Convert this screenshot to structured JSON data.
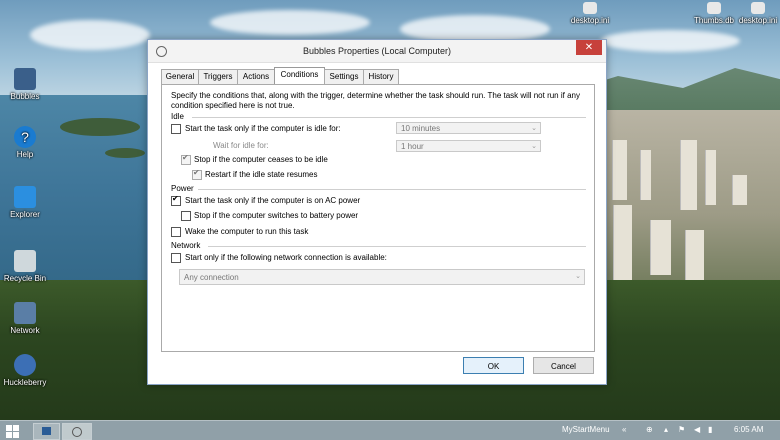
{
  "desktop": {
    "icons": [
      {
        "label": "Bubbles"
      },
      {
        "label": "Help"
      },
      {
        "label": "Explorer"
      },
      {
        "label": "Recycle Bin"
      },
      {
        "label": "Network"
      },
      {
        "label": "Huckleberry"
      }
    ],
    "top_icons": [
      {
        "label": "desktop.ini"
      },
      {
        "label": "Thumbs.db"
      },
      {
        "label": "desktop.ini"
      }
    ]
  },
  "dialog": {
    "title": "Bubbles Properties (Local Computer)",
    "close_glyph": "✕",
    "tabs": [
      "General",
      "Triggers",
      "Actions",
      "Conditions",
      "Settings",
      "History"
    ],
    "active_tab": "Conditions",
    "description": "Specify the conditions that, along with the trigger, determine whether the task should run.  The task will not run  if any condition specified here is not true.",
    "idle": {
      "header": "Idle",
      "start_if_idle": {
        "label": "Start the task only if the computer is idle for:",
        "checked": false
      },
      "idle_for_value": "10 minutes",
      "wait_label": "Wait for idle for:",
      "wait_value": "1 hour",
      "stop_if_ceases": {
        "label": "Stop if the computer ceases to be idle",
        "checked": true
      },
      "restart_if_resumes": {
        "label": "Restart if the idle state resumes",
        "checked": true
      }
    },
    "power": {
      "header": "Power",
      "ac_power": {
        "label": "Start the task only if the computer is on AC power",
        "checked": true
      },
      "battery": {
        "label": "Stop if the computer switches to battery power",
        "checked": false
      },
      "wake": {
        "label": "Wake the computer to run this task",
        "checked": false
      }
    },
    "network": {
      "header": "Network",
      "start_if_network": {
        "label": "Start only if the following network connection is available:",
        "checked": false
      },
      "connection_value": "Any connection"
    },
    "buttons": {
      "ok": "OK",
      "cancel": "Cancel"
    }
  },
  "taskbar": {
    "toolbar_label": "MyStartMenu",
    "clock": "6:05 AM"
  }
}
